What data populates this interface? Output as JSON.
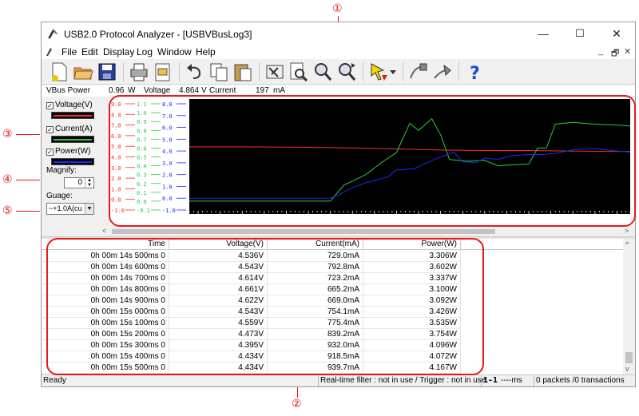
{
  "window": {
    "title": "USB2.0 Protocol Analyzer - [USBVBusLog3]",
    "controls": {
      "minimize": "—",
      "maximize": "☐",
      "close": "✕"
    }
  },
  "menu": {
    "items": [
      "File",
      "Edit",
      "Display",
      "Log",
      "Window",
      "Help"
    ],
    "mdi_controls": [
      "_",
      "🗗",
      "✕"
    ]
  },
  "toolbar": {
    "buttons": [
      "new-file-icon",
      "open-folder-icon",
      "save-icon",
      "print-icon",
      "print-preview-icon",
      "undo-icon",
      "copy-icon",
      "paste-icon",
      "settings-tools-icon",
      "search-document-icon",
      "zoom-icon",
      "find-next-icon",
      "trigger-icon",
      "dropdown-icon",
      "cable-icon",
      "cable-alt-icon",
      "help-icon"
    ]
  },
  "vbus": {
    "label": "VBus Power",
    "power_value": "0.96",
    "power_unit": "W",
    "voltage_label": "Voltage",
    "voltage_value": "4.864",
    "voltage_unit": "V",
    "current_label": "Current",
    "current_value": "197",
    "current_unit": "mA"
  },
  "left_panel": {
    "voltage_label": "Voltage(V)",
    "current_label": "Current(A)",
    "power_label": "Power(W)",
    "magnify_label": "Magnify:",
    "magnify_value": "0",
    "gauge_label": "Guage:",
    "gauge_value": "~+1.0A(cu",
    "colors": {
      "voltage": "#ff2a2a",
      "current": "#2ecc40",
      "power": "#1a2aff"
    }
  },
  "callouts": [
    "①",
    "②",
    "③",
    "④",
    "⑤"
  ],
  "chart_data": {
    "type": "line",
    "title": "",
    "background": "#000000",
    "x_ticks": [
      "3.0",
      "4.0",
      "5.0",
      "6.0",
      "7.0",
      "8.0",
      "9.0",
      "10.0",
      "11.0",
      "12.0"
    ],
    "xlim": [
      2.3,
      12.3
    ],
    "y_axes": [
      {
        "name": "Voltage(V)",
        "color": "#ff2a2a",
        "ticks": [
          "-1.0",
          "0.0",
          "1.0",
          "2.0",
          "3.0",
          "4.0",
          "5.0",
          "6.0",
          "7.0",
          "8.0",
          "9.0"
        ],
        "ylim": [
          -1,
          9
        ]
      },
      {
        "name": "Current(A)",
        "color": "#2ecc40",
        "ticks": [
          "-0.1",
          "0.0",
          "0.1",
          "0.2",
          "0.3",
          "0.4",
          "0.5",
          "0.6",
          "0.7",
          "0.8",
          "0.9",
          "1.0",
          "1.1"
        ],
        "ylim": [
          -0.1,
          1.1
        ]
      },
      {
        "name": "Power(W)",
        "color": "#1a2aff",
        "ticks": [
          "-1.0",
          "0.0",
          "1.0",
          "2.0",
          "3.0",
          "4.0",
          "5.0",
          "6.0",
          "7.0",
          "8.0"
        ],
        "ylim": [
          -1,
          8
        ]
      }
    ],
    "series": [
      {
        "name": "Voltage(V)",
        "color": "#ff2a2a",
        "x": [
          2.3,
          3.5,
          5.0,
          6.0,
          7.0,
          8.0,
          9.0,
          10.0,
          11.0,
          12.3
        ],
        "y": [
          4.95,
          4.95,
          4.9,
          4.85,
          4.75,
          4.65,
          4.6,
          4.6,
          4.55,
          4.5
        ]
      },
      {
        "name": "Current(A)",
        "color": "#2ecc40",
        "x": [
          2.3,
          5.5,
          5.6,
          5.8,
          6.1,
          6.3,
          6.7,
          7.0,
          7.3,
          7.5,
          7.8,
          8.0,
          8.2,
          8.6,
          9.0,
          9.3,
          9.6,
          10.0,
          10.2,
          10.4,
          10.6,
          11.0,
          11.5,
          12.0,
          12.3
        ],
        "y": [
          0.0,
          0.0,
          0.06,
          0.18,
          0.25,
          0.3,
          0.45,
          0.55,
          0.88,
          0.8,
          0.93,
          0.75,
          0.47,
          0.45,
          0.46,
          0.4,
          0.41,
          0.42,
          0.6,
          0.6,
          0.87,
          0.89,
          0.87,
          0.86,
          0.85
        ]
      },
      {
        "name": "Power(W)",
        "color": "#1a2aff",
        "x": [
          2.3,
          5.5,
          5.7,
          6.0,
          6.3,
          6.8,
          7.0,
          7.4,
          7.8,
          8.0,
          8.3,
          8.5,
          8.8,
          9.0,
          9.3,
          9.6,
          10.0,
          10.3,
          10.6,
          11.0,
          11.5,
          12.0,
          12.3
        ],
        "y": [
          0.0,
          0.0,
          0.3,
          0.9,
          1.3,
          1.8,
          2.4,
          2.5,
          3.2,
          3.5,
          3.9,
          3.1,
          3.0,
          3.4,
          3.3,
          3.6,
          3.7,
          3.7,
          3.8,
          4.1,
          4.2,
          4.0,
          3.9
        ]
      }
    ]
  },
  "table": {
    "columns": [
      "Time",
      "Voltage(V)",
      "Current(mA)",
      "Power(W)"
    ],
    "rows": [
      [
        "0h 00m 14s 500ms 0",
        "4.536V",
        "729.0mA",
        "3.306W"
      ],
      [
        "0h 00m 14s 600ms 0",
        "4.543V",
        "792.8mA",
        "3.602W"
      ],
      [
        "0h 00m 14s 700ms 0",
        "4.614V",
        "723.2mA",
        "3.337W"
      ],
      [
        "0h 00m 14s 800ms 0",
        "4.661V",
        "665.2mA",
        "3.100W"
      ],
      [
        "0h 00m 14s 900ms 0",
        "4.622V",
        "669.0mA",
        "3.092W"
      ],
      [
        "0h 00m 15s 000ms 0",
        "4.543V",
        "754.1mA",
        "3.426W"
      ],
      [
        "0h 00m 15s 100ms 0",
        "4.559V",
        "775.4mA",
        "3.535W"
      ],
      [
        "0h 00m 15s 200ms 0",
        "4.473V",
        "839.2mA",
        "3.754W"
      ],
      [
        "0h 00m 15s 300ms 0",
        "4.395V",
        "932.0mA",
        "4.096W"
      ],
      [
        "0h 00m 15s 400ms 0",
        "4.434V",
        "918.5mA",
        "4.072W"
      ],
      [
        "0h 00m 15s 500ms 0",
        "4.434V",
        "939.7mA",
        "4.167W"
      ]
    ]
  },
  "status": {
    "ready": "Ready",
    "filter": "Real-time filter : not in use / Trigger : not in use",
    "range": "1-1",
    "ms": "----ms",
    "packets": "0 packets /0 transactions"
  }
}
